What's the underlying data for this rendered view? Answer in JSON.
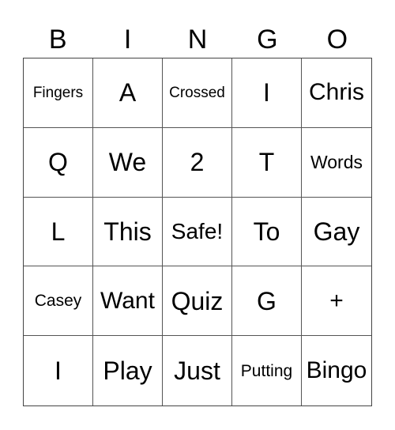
{
  "header": [
    "B",
    "I",
    "N",
    "G",
    "O"
  ],
  "rows": [
    [
      "Fingers",
      "A",
      "Crossed",
      "I",
      "Chris"
    ],
    [
      "Q",
      "We",
      "2",
      "T",
      "Words"
    ],
    [
      "L",
      "This",
      "Safe!",
      "To",
      "Gay"
    ],
    [
      "Casey",
      "Want",
      "Quiz",
      "G",
      "+"
    ],
    [
      "I",
      "Play",
      "Just",
      "Putting",
      "Bingo"
    ]
  ]
}
